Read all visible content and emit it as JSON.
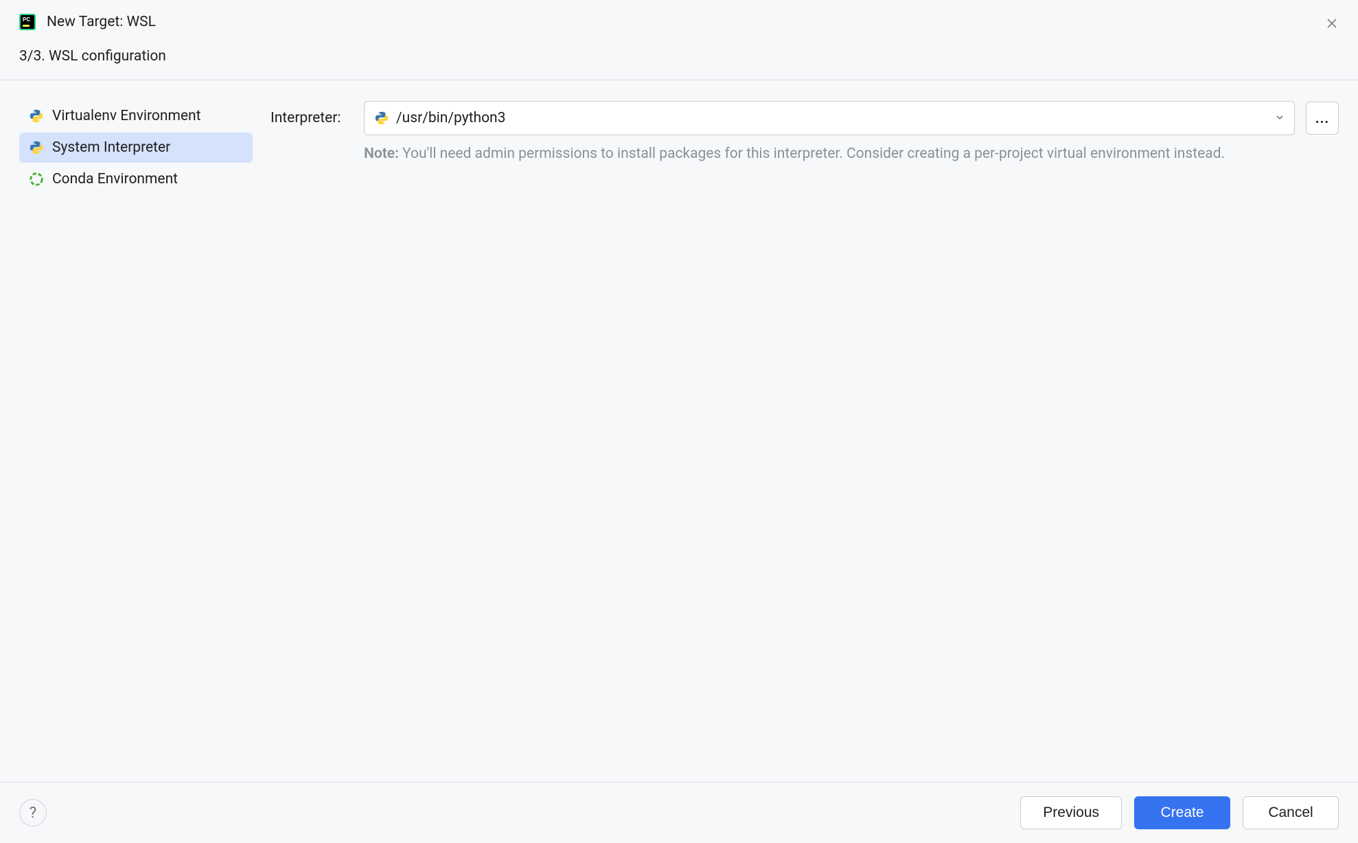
{
  "header": {
    "title": "New Target: WSL"
  },
  "subheader": {
    "text": "3/3. WSL configuration"
  },
  "sidebar": {
    "items": [
      {
        "label": "Virtualenv Environment",
        "icon": "python"
      },
      {
        "label": "System Interpreter",
        "icon": "python",
        "selected": true
      },
      {
        "label": "Conda Environment",
        "icon": "conda"
      }
    ]
  },
  "main": {
    "interpreter": {
      "label": "Interpreter:",
      "value": "/usr/bin/python3",
      "browse_button_label": "..."
    },
    "note": {
      "label": "Note:",
      "text": " You'll need admin permissions to install packages for this interpreter. Consider creating a per-project virtual environment instead."
    }
  },
  "footer": {
    "help_label": "?",
    "previous_label": "Previous",
    "create_label": "Create",
    "cancel_label": "Cancel"
  }
}
